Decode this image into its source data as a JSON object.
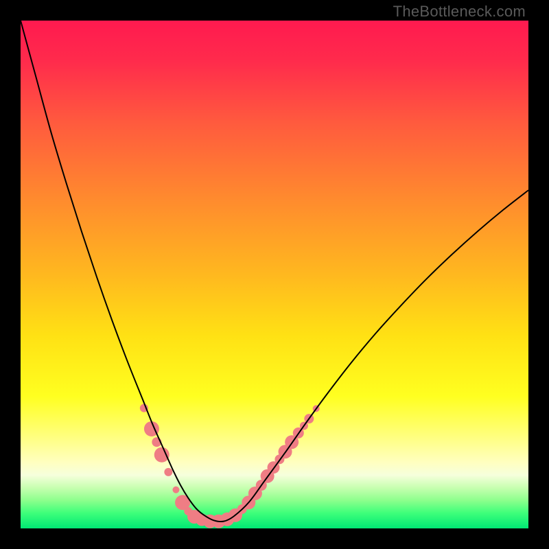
{
  "watermark": "TheBottleneck.com",
  "chart_data": {
    "type": "line",
    "title": "",
    "xlabel": "",
    "ylabel": "",
    "xlim": [
      0,
      100
    ],
    "ylim": [
      0,
      100
    ],
    "grid": false,
    "legend": false,
    "background_gradient_stops": [
      {
        "offset": 0.0,
        "color": "#ff1a4f"
      },
      {
        "offset": 0.08,
        "color": "#ff2b4c"
      },
      {
        "offset": 0.2,
        "color": "#ff5a3e"
      },
      {
        "offset": 0.35,
        "color": "#ff8a2e"
      },
      {
        "offset": 0.5,
        "color": "#ffb81f"
      },
      {
        "offset": 0.62,
        "color": "#ffe114"
      },
      {
        "offset": 0.74,
        "color": "#ffff20"
      },
      {
        "offset": 0.82,
        "color": "#ffff80"
      },
      {
        "offset": 0.87,
        "color": "#ffffc0"
      },
      {
        "offset": 0.895,
        "color": "#f6ffdc"
      },
      {
        "offset": 0.92,
        "color": "#c7ffb0"
      },
      {
        "offset": 0.945,
        "color": "#8cff8c"
      },
      {
        "offset": 0.97,
        "color": "#3dff7a"
      },
      {
        "offset": 1.0,
        "color": "#00e874"
      }
    ],
    "series": [
      {
        "name": "bottleneck-curve",
        "color": "#000000",
        "stroke_width": 2,
        "x": [
          0,
          3,
          6,
          9,
          12,
          15,
          18,
          21,
          24,
          26,
          28,
          30,
          31.5,
          33,
          34.5,
          36,
          38,
          40,
          42,
          45,
          48,
          52,
          56,
          60,
          65,
          70,
          75,
          80,
          85,
          90,
          95,
          100
        ],
        "y": [
          100,
          89,
          78,
          68,
          58.5,
          49.5,
          41,
          33,
          25.5,
          20.5,
          16,
          11.5,
          8.5,
          6,
          4,
          2.7,
          1.6,
          1.4,
          2.4,
          5.2,
          9.3,
          14.8,
          20.5,
          26,
          32.5,
          38.5,
          44,
          49.2,
          54,
          58.5,
          62.7,
          66.6
        ]
      }
    ],
    "scatter_overlay": {
      "name": "highlight-dots",
      "color": "#ef7d84",
      "points": [
        {
          "x": 24.3,
          "y": 23.7,
          "r": 6
        },
        {
          "x": 25.8,
          "y": 19.6,
          "r": 11
        },
        {
          "x": 26.8,
          "y": 17.0,
          "r": 7
        },
        {
          "x": 27.8,
          "y": 14.5,
          "r": 11
        },
        {
          "x": 29.1,
          "y": 11.1,
          "r": 6
        },
        {
          "x": 30.6,
          "y": 7.6,
          "r": 5
        },
        {
          "x": 31.9,
          "y": 5.1,
          "r": 11
        },
        {
          "x": 33.0,
          "y": 3.4,
          "r": 6
        },
        {
          "x": 34.2,
          "y": 2.3,
          "r": 10
        },
        {
          "x": 35.7,
          "y": 1.7,
          "r": 9
        },
        {
          "x": 37.3,
          "y": 1.4,
          "r": 10
        },
        {
          "x": 39.0,
          "y": 1.4,
          "r": 10
        },
        {
          "x": 40.7,
          "y": 1.8,
          "r": 10
        },
        {
          "x": 42.3,
          "y": 2.6,
          "r": 10
        },
        {
          "x": 43.6,
          "y": 3.8,
          "r": 7
        },
        {
          "x": 44.9,
          "y": 5.1,
          "r": 10
        },
        {
          "x": 46.2,
          "y": 6.9,
          "r": 10
        },
        {
          "x": 47.4,
          "y": 8.5,
          "r": 8
        },
        {
          "x": 48.6,
          "y": 10.3,
          "r": 10
        },
        {
          "x": 49.8,
          "y": 12.0,
          "r": 9
        },
        {
          "x": 51.0,
          "y": 13.6,
          "r": 7
        },
        {
          "x": 52.1,
          "y": 15.1,
          "r": 10
        },
        {
          "x": 53.4,
          "y": 17.0,
          "r": 10
        },
        {
          "x": 54.7,
          "y": 18.8,
          "r": 8
        },
        {
          "x": 55.8,
          "y": 20.2,
          "r": 6
        },
        {
          "x": 56.8,
          "y": 21.6,
          "r": 7
        },
        {
          "x": 58.2,
          "y": 23.6,
          "r": 5
        }
      ]
    }
  }
}
